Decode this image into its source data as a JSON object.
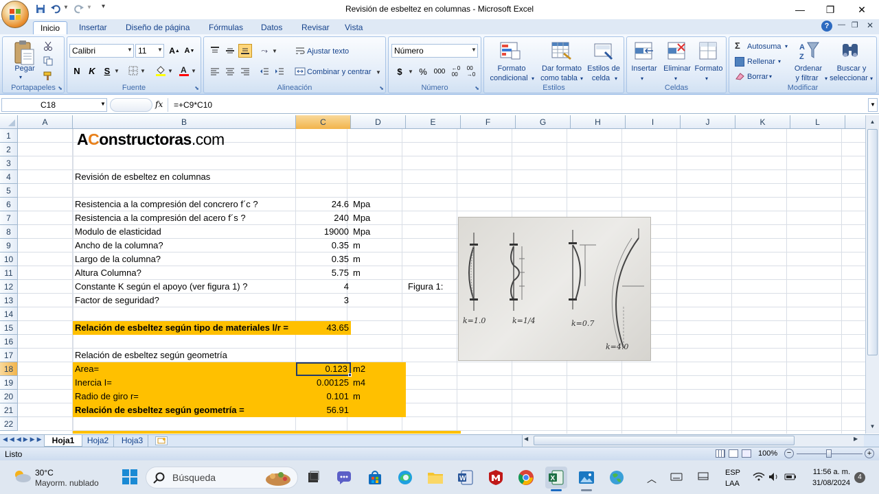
{
  "window": {
    "title": "Revisión de esbeltez en columnas - Microsoft Excel",
    "minimize": "—",
    "maximize": "❐",
    "close": "✕"
  },
  "ribbon": {
    "tabs": [
      "Inicio",
      "Insertar",
      "Diseño de página",
      "Fórmulas",
      "Datos",
      "Revisar",
      "Vista"
    ],
    "portapapeles": {
      "label": "Portapapeles",
      "pegar": "Pegar"
    },
    "fuente": {
      "label": "Fuente",
      "font_name": "Calibri",
      "font_size": "11",
      "bold": "N",
      "italic": "K",
      "underline": "S"
    },
    "alineacion": {
      "label": "Alineación",
      "wrap": "Ajustar texto",
      "merge": "Combinar y centrar"
    },
    "numero": {
      "label": "Número",
      "format": "Número",
      "currency": "$",
      "percent": "%",
      "thousands": "000"
    },
    "estilos": {
      "label": "Estilos",
      "cond_1": "Formato",
      "cond_2": "condicional",
      "table_1": "Dar formato",
      "table_2": "como tabla",
      "cell_1": "Estilos de",
      "cell_2": "celda"
    },
    "celdas": {
      "label": "Celdas",
      "insertar": "Insertar",
      "eliminar": "Eliminar",
      "formato": "Formato"
    },
    "modificar": {
      "label": "Modificar",
      "autosuma": "Autosuma",
      "rellenar": "Rellenar",
      "borrar": "Borrar",
      "ordenar_1": "Ordenar",
      "ordenar_2": "y filtrar",
      "buscar_1": "Buscar y",
      "buscar_2": "seleccionar"
    }
  },
  "formula_bar": {
    "name_box": "C18",
    "fx": "fx",
    "formula": "=+C9*C10"
  },
  "columns": [
    "A",
    "B",
    "C",
    "D",
    "E",
    "F",
    "G",
    "H",
    "I",
    "J",
    "K",
    "L"
  ],
  "rows": [
    "1",
    "2",
    "3",
    "4",
    "5",
    "6",
    "7",
    "8",
    "9",
    "10",
    "11",
    "12",
    "13",
    "14",
    "15",
    "16",
    "17",
    "18",
    "19",
    "20",
    "21",
    "22"
  ],
  "logo": {
    "prefix": "A",
    "highlight": "C",
    "rest": "onstructoras",
    "suffix": ".com"
  },
  "cells": {
    "b4": "Revisión de esbeltez en columnas",
    "b6": "Resistencia a la compresión del concrero f´c ?",
    "c6": "24.6",
    "d6": "Mpa",
    "b7": "Resistencia a la compresión del acero f´s ?",
    "c7": "240",
    "d7": "Mpa",
    "b8": "Modulo de elasticidad",
    "c8": "19000",
    "d8": "Mpa",
    "b9": "Ancho de la columna?",
    "c9": "0.35",
    "d9": "m",
    "b10": "Largo de la columna?",
    "c10": "0.35",
    "d10": "m",
    "b11": "Altura Columna?",
    "c11": "5.75",
    "d11": "m",
    "b12": "Constante K según el apoyo (ver figura 1) ?",
    "c12": "4",
    "e12": "Figura 1:",
    "b13": "Factor de seguridad?",
    "c13": "3",
    "b15": "Relación de esbeltez según tipo de materiales l/r =",
    "c15": "43.65",
    "b17": "Relación de esbeltez según geometría",
    "b18": "Area=",
    "c18": "0.123",
    "d18": "m2",
    "b19": "Inercia I=",
    "c19": "0.00125",
    "d19": "m4",
    "b20": "Radio de giro r=",
    "c20": "0.101",
    "d20": "m",
    "b21": "Relación de esbeltez según geometría =",
    "c21": "56.91"
  },
  "figure": {
    "k1": "k=1.0",
    "k2": "k=1/4",
    "k3": "k=0.7",
    "k4": "k=4.0"
  },
  "sheets": [
    "Hoja1",
    "Hoja2",
    "Hoja3"
  ],
  "status": {
    "text": "Listo",
    "zoom": "100%"
  },
  "taskbar": {
    "weather_temp": "30°C",
    "weather_desc": "Mayorm. nublado",
    "search_placeholder": "Búsqueda",
    "lang_1": "ESP",
    "lang_2": "LAA",
    "time": "11:56 a. m.",
    "date": "31/08/2024",
    "notifications": "4"
  },
  "colors": {
    "accent": "#ffc000",
    "ribbon_text": "#15428b",
    "excel_green": "#1d7044"
  }
}
